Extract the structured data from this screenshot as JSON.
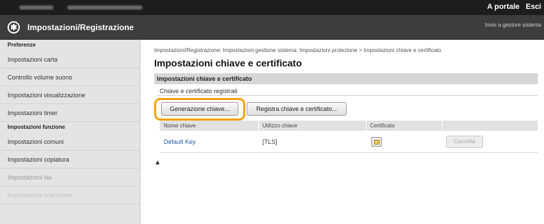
{
  "topbar": {
    "portal_link": "A portale",
    "logout_link": "Esci"
  },
  "header": {
    "app_icon": "settings-tool-icon",
    "app_title": "Impostazioni/Registrazione",
    "home_link": "Invio a gestore sistema"
  },
  "sidebar": {
    "preferences_heading": "Preferenze",
    "preferences_items": [
      "Impostazioni carta",
      "Controllo volume suono",
      "Impostazioni visualizzazione",
      "Impostazioni timer"
    ],
    "function_heading": "Impostazioni funzione",
    "function_items": [
      "Impostazioni comuni",
      "Impostazioni copiatura",
      "Impostazioni fax",
      "Impostazioni scansione"
    ]
  },
  "main": {
    "breadcrumb": "Impostazioni/Registrazione: Impostazioni gestione sistema: Impostazioni protezione > Impostazioni chiave e certificato",
    "page_title": "Impostazioni chiave e certificato",
    "section_title": "Impostazioni chiave e certificato",
    "subtitle": "Chiave e certificato registrati",
    "generate_key_button": "Generazione chiave...",
    "register_button": "Registra chiave e certificato...",
    "columns": [
      "Nome chiave",
      "Utilizzo chiave",
      "Certificato"
    ],
    "rows": [
      {
        "key_name": "Default Key",
        "key_usage": "[TLS]",
        "certificate_icon": "certificate-icon",
        "delete_label": "Cancella"
      }
    ],
    "back_to_top": "▲"
  },
  "colors": {
    "topbar_bg": "#1d1d1d",
    "header_bg": "#3d3d3d",
    "sidebar_bg": "#e4e4e4",
    "highlight": "#f2a20c",
    "link": "#1f5aa6"
  }
}
